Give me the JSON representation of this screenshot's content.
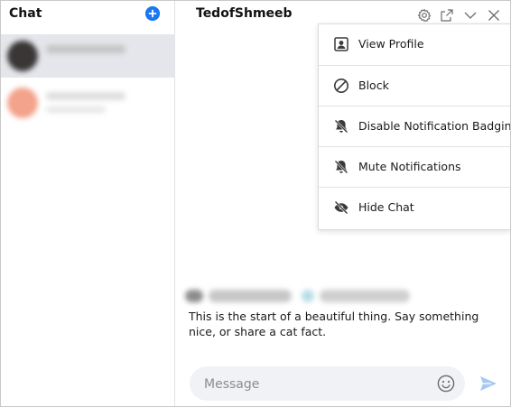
{
  "sidebar": {
    "title": "Chat",
    "new_chat_icon": "plus-circle-icon",
    "conversations": [
      {
        "state": "active"
      },
      {
        "state": "inactive"
      }
    ]
  },
  "header": {
    "contact_name": "TedofShmeeb",
    "icons": [
      "gear-icon",
      "pop-out-icon",
      "chevron-down-icon",
      "close-icon"
    ]
  },
  "menu": {
    "items": [
      {
        "label": "View Profile",
        "icon": "profile-icon"
      },
      {
        "label": "Block",
        "icon": "block-icon"
      },
      {
        "label": "Disable Notification Badging",
        "icon": "bell-off-icon"
      },
      {
        "label": "Mute Notifications",
        "icon": "bell-mute-icon"
      },
      {
        "label": "Hide Chat",
        "icon": "eye-off-icon"
      }
    ]
  },
  "conversation": {
    "intro_text": "This is the start of a beautiful thing. Say something nice, or share a cat fact."
  },
  "composer": {
    "placeholder": "Message",
    "value": ""
  },
  "colors": {
    "accent": "#1877f2",
    "send_icon": "#a7c8f2",
    "active_row": "#e4e6eb"
  }
}
